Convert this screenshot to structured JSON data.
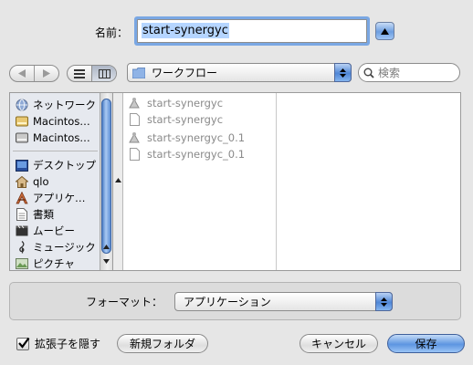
{
  "dialog": {
    "name_label": "名前：",
    "name_value": "start-synergyc"
  },
  "toolbar": {
    "location": "ワークフロー",
    "search_placeholder": "検索"
  },
  "sidebar": {
    "items": [
      {
        "label": "ネットワーク",
        "icon": "network-globe-icon"
      },
      {
        "label": "Macintos…",
        "icon": "hard-disk-icon"
      },
      {
        "label": "Macintos…",
        "icon": "hard-disk-icon"
      },
      {
        "label": "デスクトップ",
        "icon": "desktop-icon"
      },
      {
        "label": "qlo",
        "icon": "home-icon"
      },
      {
        "label": "アプリケ…",
        "icon": "applications-icon"
      },
      {
        "label": "書類",
        "icon": "documents-icon"
      },
      {
        "label": "ムービー",
        "icon": "movies-icon"
      },
      {
        "label": "ミュージック",
        "icon": "music-icon"
      },
      {
        "label": "ピクチャ",
        "icon": "pictures-icon"
      }
    ]
  },
  "files": [
    {
      "name": "start-synergyc",
      "icon": "automator-icon"
    },
    {
      "name": "start-synergyc",
      "icon": "document-icon"
    },
    {
      "name": "start-synergyc_0.1",
      "icon": "automator-icon"
    },
    {
      "name": "start-synergyc_0.1",
      "icon": "document-icon"
    }
  ],
  "format": {
    "label": "フォーマット：",
    "value": "アプリケーション"
  },
  "buttons": {
    "hide_extension": "拡張子を隠す",
    "new_folder": "新規フォルダ",
    "cancel": "キャンセル",
    "save": "保存"
  },
  "colors": {
    "accent": "#5d95e1",
    "selection": "#b5d5ff",
    "sidebar_bg": "#e6e9ef"
  }
}
